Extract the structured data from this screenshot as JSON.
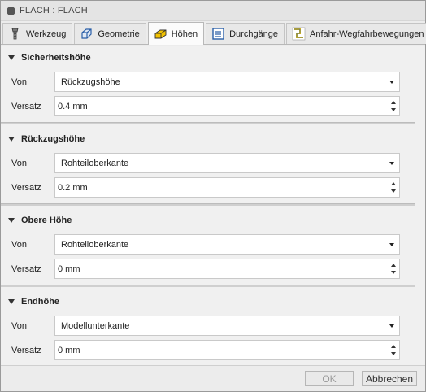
{
  "window": {
    "title": "FLACH : FLACH"
  },
  "tabs": [
    {
      "label": "Werkzeug",
      "icon": "tool-icon"
    },
    {
      "label": "Geometrie",
      "icon": "geometry-icon"
    },
    {
      "label": "Höhen",
      "icon": "heights-icon",
      "active": true
    },
    {
      "label": "Durchgänge",
      "icon": "passes-icon"
    },
    {
      "label": "Anfahr-Wegfahrbewegungen",
      "icon": "linking-icon"
    }
  ],
  "sections": [
    {
      "title": "Sicherheitshöhe",
      "von_label": "Von",
      "von_value": "Rückzugshöhe",
      "versatz_label": "Versatz",
      "versatz_value": "0.4 mm"
    },
    {
      "title": "Rückzugshöhe",
      "von_label": "Von",
      "von_value": "Rohteiloberkante",
      "versatz_label": "Versatz",
      "versatz_value": "0.2  mm"
    },
    {
      "title": "Obere Höhe",
      "von_label": "Von",
      "von_value": "Rohteiloberkante",
      "versatz_label": "Versatz",
      "versatz_value": "0  mm"
    },
    {
      "title": "Endhöhe",
      "von_label": "Von",
      "von_value": "Modellunterkante",
      "versatz_label": "Versatz",
      "versatz_value": "0  mm"
    }
  ],
  "footer": {
    "ok_label": "OK",
    "cancel_label": "Abbrechen"
  },
  "colors": {
    "accent_yellow": "#f2c200",
    "icon_blue": "#2a5fa8"
  }
}
